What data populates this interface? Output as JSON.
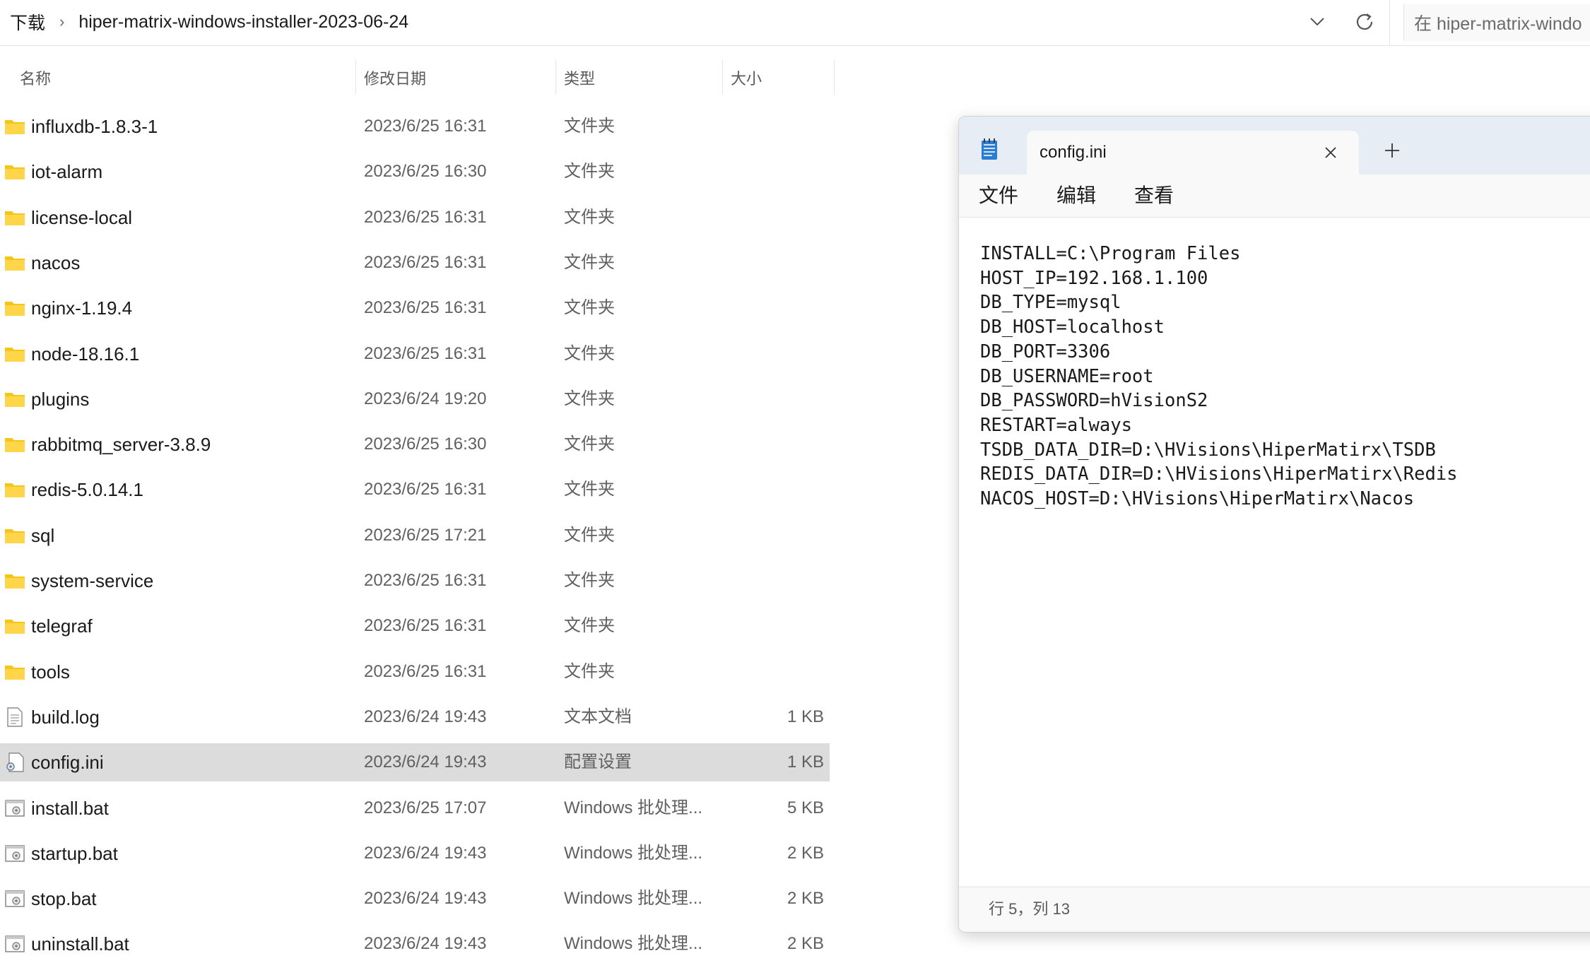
{
  "explorer": {
    "breadcrumb": [
      "下载",
      "hiper-matrix-windows-installer-2023-06-24"
    ],
    "breadcrumb_separator": "›",
    "search_placeholder": "在 hiper-matrix-windo",
    "columns": {
      "name": "名称",
      "date": "修改日期",
      "type": "类型",
      "size": "大小"
    },
    "files": [
      {
        "name": "influxdb-1.8.3-1",
        "date": "2023/6/25 16:31",
        "type": "文件夹",
        "size": "",
        "icon": "folder-icon"
      },
      {
        "name": "iot-alarm",
        "date": "2023/6/25 16:30",
        "type": "文件夹",
        "size": "",
        "icon": "folder-icon"
      },
      {
        "name": "license-local",
        "date": "2023/6/25 16:31",
        "type": "文件夹",
        "size": "",
        "icon": "folder-icon"
      },
      {
        "name": "nacos",
        "date": "2023/6/25 16:31",
        "type": "文件夹",
        "size": "",
        "icon": "folder-icon"
      },
      {
        "name": "nginx-1.19.4",
        "date": "2023/6/25 16:31",
        "type": "文件夹",
        "size": "",
        "icon": "folder-icon"
      },
      {
        "name": "node-18.16.1",
        "date": "2023/6/25 16:31",
        "type": "文件夹",
        "size": "",
        "icon": "folder-icon"
      },
      {
        "name": "plugins",
        "date": "2023/6/24 19:20",
        "type": "文件夹",
        "size": "",
        "icon": "folder-icon"
      },
      {
        "name": "rabbitmq_server-3.8.9",
        "date": "2023/6/25 16:30",
        "type": "文件夹",
        "size": "",
        "icon": "folder-icon"
      },
      {
        "name": "redis-5.0.14.1",
        "date": "2023/6/25 16:31",
        "type": "文件夹",
        "size": "",
        "icon": "folder-icon"
      },
      {
        "name": "sql",
        "date": "2023/6/25 17:21",
        "type": "文件夹",
        "size": "",
        "icon": "folder-icon"
      },
      {
        "name": "system-service",
        "date": "2023/6/25 16:31",
        "type": "文件夹",
        "size": "",
        "icon": "folder-icon"
      },
      {
        "name": "telegraf",
        "date": "2023/6/25 16:31",
        "type": "文件夹",
        "size": "",
        "icon": "folder-icon"
      },
      {
        "name": "tools",
        "date": "2023/6/25 16:31",
        "type": "文件夹",
        "size": "",
        "icon": "folder-icon"
      },
      {
        "name": "build.log",
        "date": "2023/6/24 19:43",
        "type": "文本文档",
        "size": "1 KB",
        "icon": "text-file-icon"
      },
      {
        "name": "config.ini",
        "date": "2023/6/24 19:43",
        "type": "配置设置",
        "size": "1 KB",
        "icon": "config-file-icon",
        "selected": true
      },
      {
        "name": "install.bat",
        "date": "2023/6/25 17:07",
        "type": "Windows 批处理...",
        "size": "5 KB",
        "icon": "batch-file-icon"
      },
      {
        "name": "startup.bat",
        "date": "2023/6/24 19:43",
        "type": "Windows 批处理...",
        "size": "2 KB",
        "icon": "batch-file-icon"
      },
      {
        "name": "stop.bat",
        "date": "2023/6/24 19:43",
        "type": "Windows 批处理...",
        "size": "2 KB",
        "icon": "batch-file-icon"
      },
      {
        "name": "uninstall.bat",
        "date": "2023/6/24 19:43",
        "type": "Windows 批处理...",
        "size": "2 KB",
        "icon": "batch-file-icon"
      }
    ]
  },
  "notepad": {
    "tab_title": "config.ini",
    "menu": {
      "file": "文件",
      "edit": "编辑",
      "view": "查看"
    },
    "lines": [
      "INSTALL=C:\\Program Files",
      "HOST_IP=192.168.1.100",
      "DB_TYPE=mysql",
      "DB_HOST=localhost",
      "DB_PORT=3306",
      "DB_USERNAME=root",
      "DB_PASSWORD=hVisionS2",
      "RESTART=always",
      "TSDB_DATA_DIR=D:\\HVisions\\HiperMatirx\\TSDB",
      "REDIS_DATA_DIR=D:\\HVisions\\HiperMatirx\\Redis",
      "NACOS_HOST=D:\\HVisions\\HiperMatirx\\Nacos"
    ],
    "status": "行 5，列 13"
  },
  "colors": {
    "folder": "#F5C518",
    "selected_row": "#DCDCDC",
    "notepad_titlebar": "#E6EDF5",
    "notepad_icon": "#2B7CD3"
  }
}
